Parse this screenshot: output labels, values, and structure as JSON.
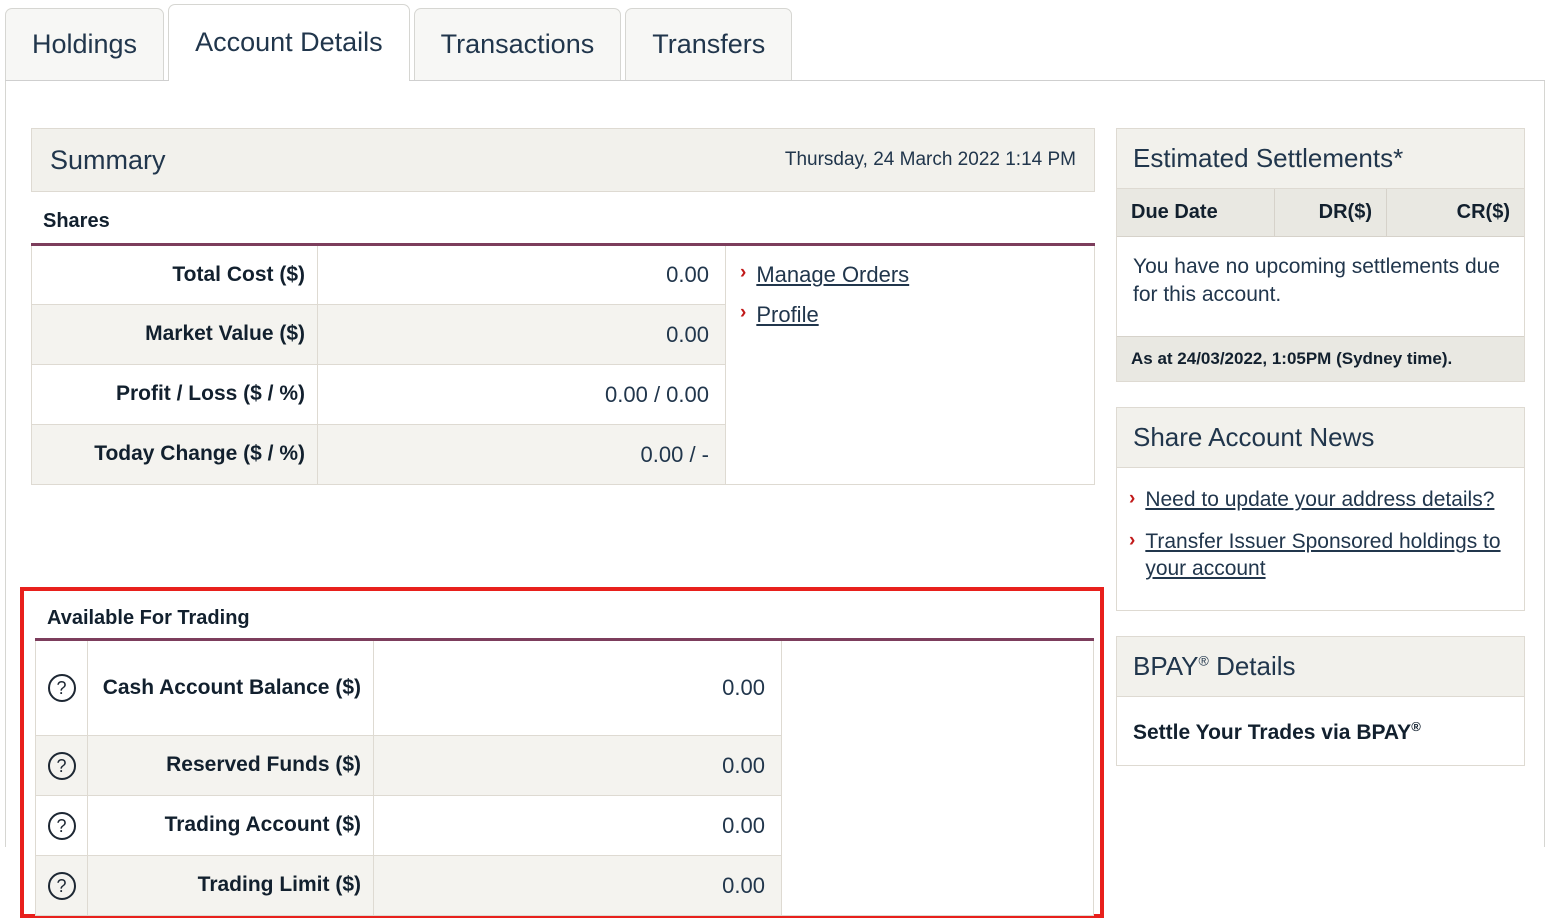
{
  "tabs": [
    {
      "label": "Holdings",
      "active": false
    },
    {
      "label": "Account Details",
      "active": true
    },
    {
      "label": "Transactions",
      "active": false
    },
    {
      "label": "Transfers",
      "active": false
    }
  ],
  "summary": {
    "title": "Summary",
    "datetime": "Thursday, 24 March 2022 1:14 PM"
  },
  "shares": {
    "heading": "Shares",
    "rows": [
      {
        "label": "Total Cost ($)",
        "value": "0.00"
      },
      {
        "label": "Market Value ($)",
        "value": "0.00"
      },
      {
        "label": "Profit / Loss ($ / %)",
        "value": "0.00 / 0.00"
      },
      {
        "label": "Today Change ($ / %)",
        "value": "0.00 / -"
      }
    ],
    "links": [
      {
        "label": "Manage Orders"
      },
      {
        "label": "Profile"
      }
    ]
  },
  "available_for_trading": {
    "heading": "Available For Trading",
    "help_icon": "?",
    "rows": [
      {
        "label": "Cash Account Balance ($)",
        "value": "0.00"
      },
      {
        "label": "Reserved Funds ($)",
        "value": "0.00"
      },
      {
        "label": "Trading Account ($)",
        "value": "0.00"
      },
      {
        "label": "Trading Limit ($)",
        "value": "0.00"
      }
    ]
  },
  "settlements": {
    "title": "Estimated Settlements*",
    "columns": [
      "Due Date",
      "DR($)",
      "CR($)"
    ],
    "empty_message": "You have no upcoming settlements due for this account.",
    "as_at": "As at 24/03/2022, 1:05PM (Sydney time)."
  },
  "news": {
    "title": "Share Account News",
    "items": [
      {
        "label": "Need to update your address details?"
      },
      {
        "label": "Transfer Issuer Sponsored holdings to your account"
      }
    ]
  },
  "bpay": {
    "title_prefix": "BPAY",
    "title_sup": "®",
    "title_suffix": " Details",
    "body_prefix": "Settle Your Trades via BPAY",
    "body_sup": "®"
  },
  "colors": {
    "accent_purple": "#7c3d5c",
    "link_red_chevron": "#c11a1a",
    "highlight_red": "#e8201c",
    "header_grey": "#f2f1ec",
    "row_alt_grey": "#f4f3ef",
    "text_dark": "#21364c"
  }
}
